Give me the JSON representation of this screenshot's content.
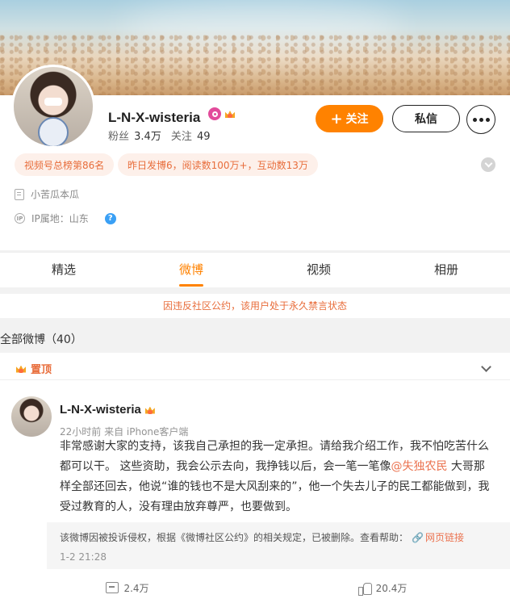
{
  "colors": {
    "accent": "#ff8200",
    "warning_text": "#e86d3b",
    "mention": "#eb7350",
    "help_blue": "#3aa0f5"
  },
  "profile": {
    "name": "L-N-X-wisteria",
    "fans_label": "粉丝",
    "fans_count": "3.4万",
    "following_label": "关注",
    "following_count": "49",
    "follow_button": "关注",
    "message_button": "私信",
    "chips": [
      "视频号总榜第86名",
      "昨日发博6，阅读数100万+，互动数13万"
    ],
    "info": {
      "tag": "小苦瓜本瓜",
      "ip": "IP属地：山东"
    },
    "icons": [
      "membership-icon",
      "crown-badge-icon",
      "more-icon",
      "expand-chevron-icon",
      "doc-icon",
      "ip-icon",
      "help-icon"
    ]
  },
  "tabs": [
    {
      "label": "精选",
      "active": false
    },
    {
      "label": "微博",
      "active": true
    },
    {
      "label": "视频",
      "active": false
    },
    {
      "label": "相册",
      "active": false
    }
  ],
  "ban_notice": "因违反社区公约，该用户处于永久禁言状态",
  "all_posts_label": "全部微博（40）",
  "pinned_post": {
    "pin_label": "置顶",
    "author": "L-N-X-wisteria",
    "meta": "22小时前  来自 iPhone客户端",
    "text_before": "非常感谢大家的支持，该我自己承担的我一定承担。请给我介绍工作，我不怕吃苦什么都可以干。 这些资助，我会公示去向，我挣钱以后，会一笔一笔像",
    "mention": "@失独农民",
    "text_after": " 大哥那样全部还回去，他说“谁的钱也不是大风刮来的”，他一个失去儿子的民工都能做到，我受过教育的人，没有理由放弃尊严，也要做到。",
    "deleted_notice": "该微博因被投诉侵权，根据《微博社区公约》的相关规定，已被删除。查看帮助：",
    "help_link": "网页链接",
    "time": "1-2 21:28",
    "comments": "2.4万",
    "likes": "20.4万"
  }
}
